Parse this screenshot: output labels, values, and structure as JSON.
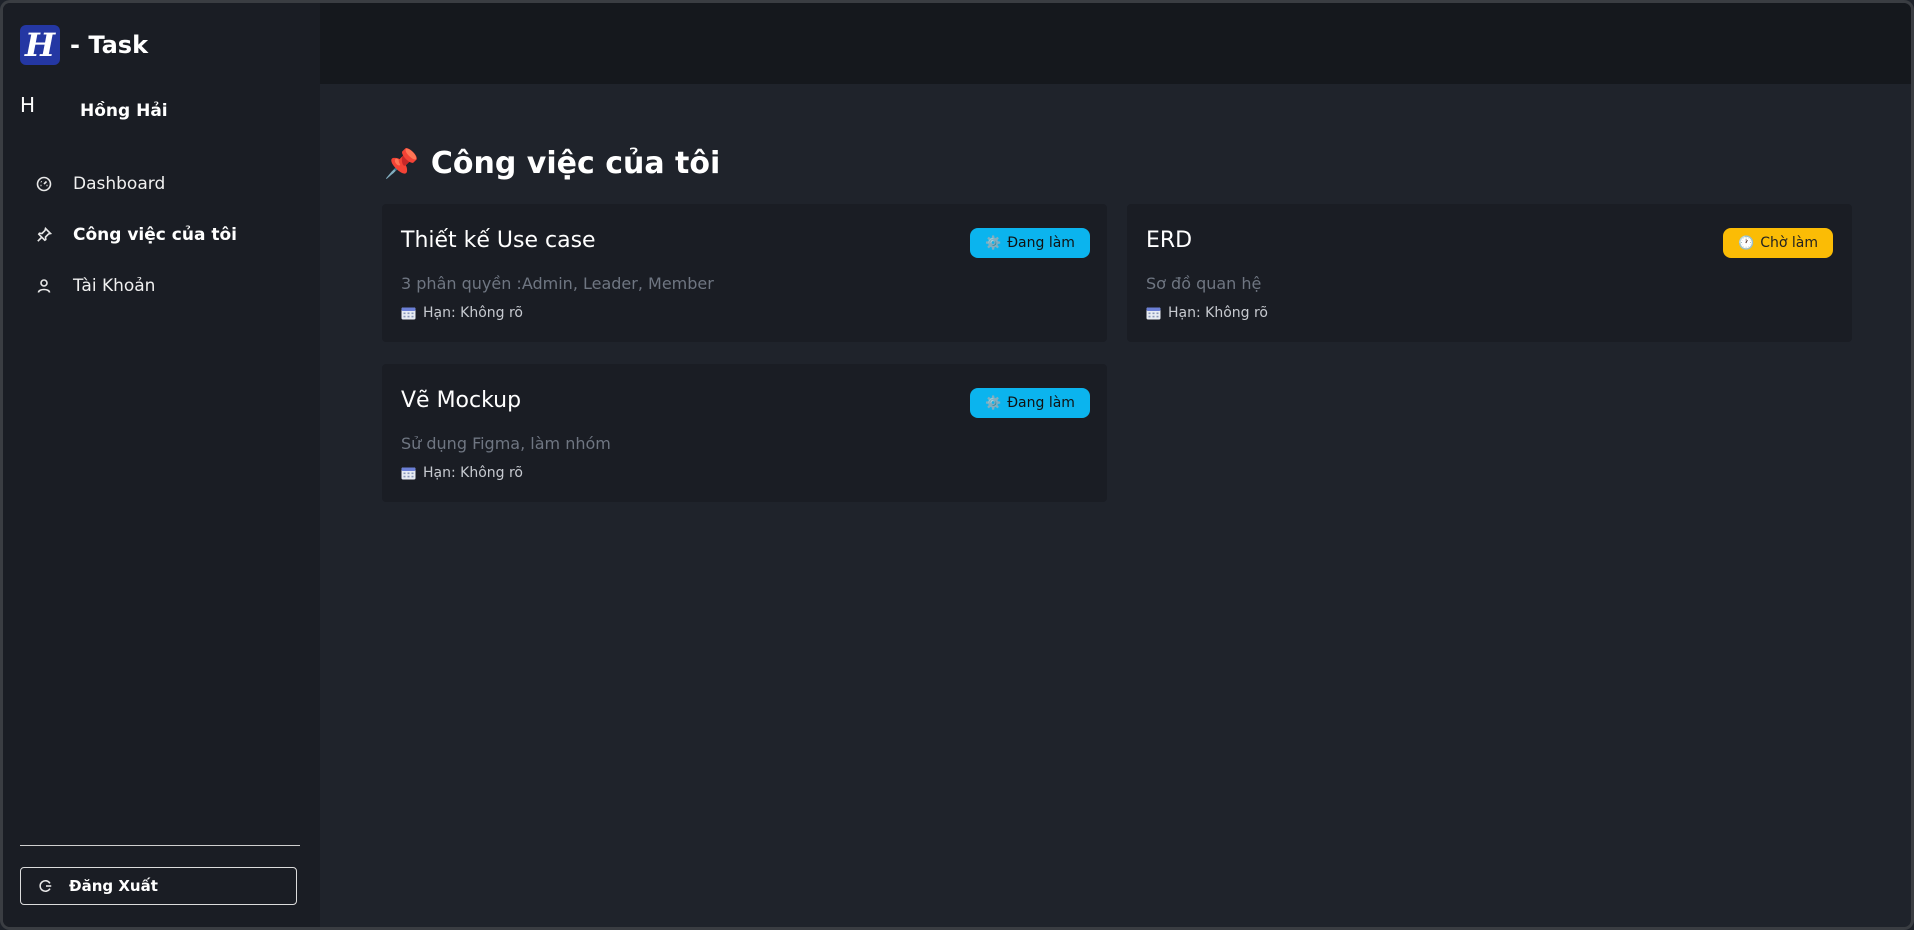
{
  "app": {
    "logo_letter": "H",
    "title": "- Task"
  },
  "user": {
    "initial": "H",
    "name": "Hồng Hải"
  },
  "nav": [
    {
      "label": "Dashboard",
      "icon": "gauge-icon",
      "active": false
    },
    {
      "label": "Công việc của tôi",
      "icon": "pin-icon",
      "active": true
    },
    {
      "label": "Tài Khoản",
      "icon": "user-icon",
      "active": false
    }
  ],
  "logout": {
    "label": "Đăng Xuất",
    "icon": "logout-icon"
  },
  "page": {
    "emoji": "📌",
    "title": "Công việc của tôi"
  },
  "tasks": [
    {
      "title": "Thiết kế Use case",
      "description": "3 phân quyền :Admin, Leader, Member",
      "due": "Hạn: Không rõ",
      "status": "Đang làm",
      "status_icon": "⚙️",
      "status_type": "doing"
    },
    {
      "title": "ERD",
      "description": "Sơ đồ quan hệ",
      "due": "Hạn: Không rõ",
      "status": "Chờ làm",
      "status_icon": "🕐",
      "status_type": "waiting"
    },
    {
      "title": "Vẽ Mockup",
      "description": "Sử dụng Figma, làm nhóm",
      "due": "Hạn: Không rõ",
      "status": "Đang làm",
      "status_icon": "⚙️",
      "status_type": "doing"
    }
  ],
  "colors": {
    "accent_doing": "#0bb4ee",
    "accent_waiting": "#fbbc05",
    "logo_bg": "#2437a3"
  }
}
